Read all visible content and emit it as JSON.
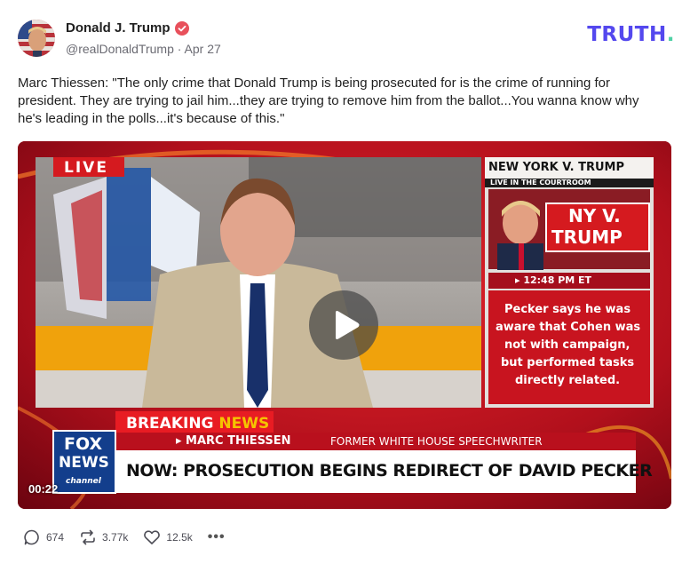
{
  "post": {
    "author_name": "Donald J. Trump",
    "handle": "@realDonaldTrump",
    "separator": "·",
    "date": "Apr 27",
    "text": "Marc Thiessen: \"The only crime that Donald Trump is being prosecuted for is the crime of running for president. They are trying to jail him...they are trying to remove him from the ballot...You wanna know why he's leading in the polls...it's because of this.\""
  },
  "brand": {
    "logo_text": "TRUTH",
    "logo_dot": ".",
    "accent": "#5448ee",
    "dot_color": "#4fd1a5"
  },
  "video": {
    "timestamp": "00:22",
    "live_badge": "LIVE",
    "side_title": "NEW YORK V. TRUMP",
    "side_subtitle": "LIVE IN THE COURTROOM",
    "side_card_line1": "NY V.",
    "side_card_line2": "TRUMP",
    "side_time": "▸ 12:48 PM ET",
    "side_text_1": "Pecker says he was",
    "side_text_2": "aware that Cohen was",
    "side_text_3": "not with campaign,",
    "side_text_4": "but performed tasks",
    "side_text_5": "directly related.",
    "breaking_1": "BREAKING",
    "breaking_2": "NEWS",
    "lower_third_name": "▸ MARC THIESSEN",
    "lower_third_role": "FORMER WHITE HOUSE SPEECHWRITER",
    "headline": "NOW: PROSECUTION BEGINS REDIRECT OF DAVID PECKER",
    "network_1": "FOX",
    "network_2": "NEWS",
    "network_3": "channel"
  },
  "actions": {
    "replies": "674",
    "retruths": "3.77k",
    "likes": "12.5k",
    "more": "•••"
  }
}
